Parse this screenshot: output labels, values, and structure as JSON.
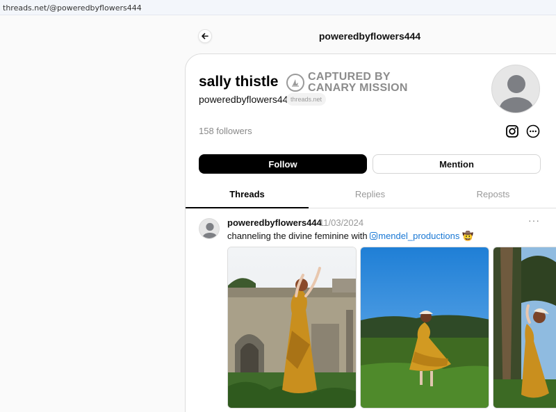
{
  "browser": {
    "url": "threads.net/@poweredbyflowers444"
  },
  "header": {
    "username": "poweredbyflowers444"
  },
  "profile": {
    "display_name": "sally thistle",
    "handle": "poweredbyflowers444",
    "domain_badge": "threads.net",
    "followers": "158 followers",
    "follow_label": "Follow",
    "mention_label": "Mention"
  },
  "stamp": {
    "line1": "CAPTURED BY",
    "line2": "CANARY MISSION"
  },
  "tabs": [
    {
      "label": "Threads",
      "active": true
    },
    {
      "label": "Replies",
      "active": false
    },
    {
      "label": "Reposts",
      "active": false
    }
  ],
  "post": {
    "username": "poweredbyflowers444",
    "date": "11/03/2024",
    "more": "···",
    "text_prefix": "channeling the divine feminine with ",
    "mention": "mendel_productions",
    "emoji": "🤠",
    "images": [
      {
        "name": "photo-1",
        "desc_icon": "image"
      },
      {
        "name": "photo-2",
        "desc_icon": "image"
      },
      {
        "name": "photo-3",
        "desc_icon": "image"
      }
    ]
  },
  "icons": {
    "back": "arrow-left-icon",
    "instagram": "instagram-icon",
    "more": "more-circle-icon",
    "stamp": "canary-stamp-icon"
  },
  "colors": {
    "follow_bg": "#000000",
    "mention_link": "#1877d4",
    "stamp_gray": "#8c8c8c"
  }
}
